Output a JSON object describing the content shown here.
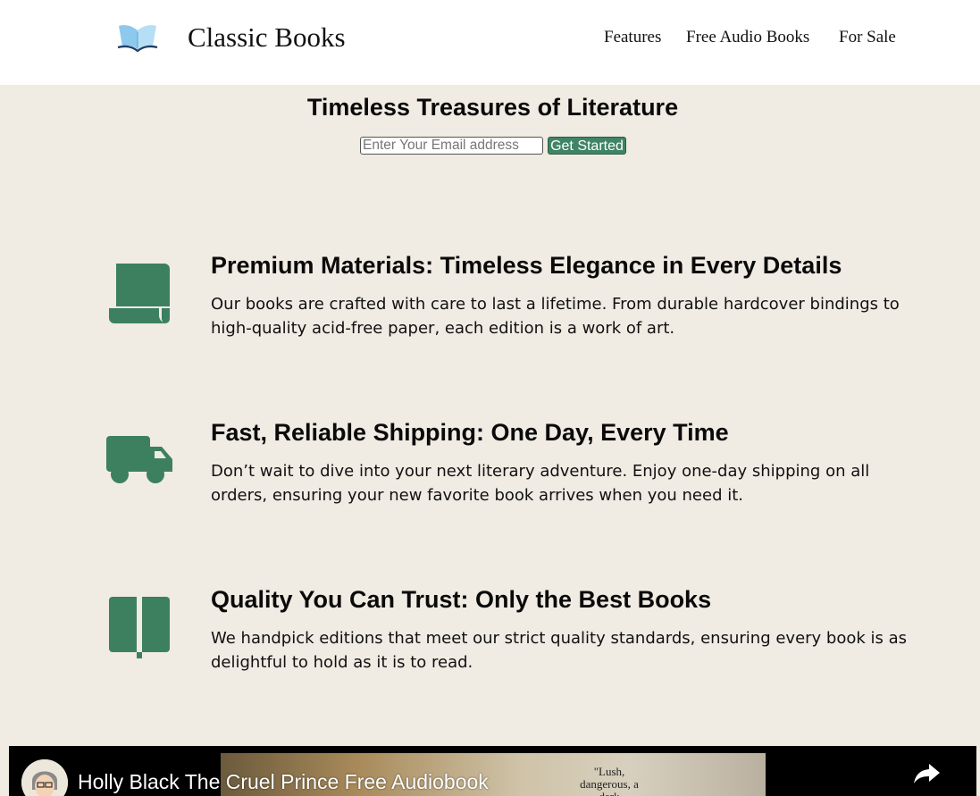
{
  "header": {
    "brand": "Classic Books",
    "nav": {
      "features": "Features",
      "audio": "Free Audio Books",
      "sale": "For Sale"
    }
  },
  "hero": {
    "title": "Timeless Treasures of Literature",
    "email_placeholder": "Enter Your Email address",
    "email_value": "",
    "cta_label": "Get Started"
  },
  "features": [
    {
      "icon": "scroll-icon",
      "title": "Premium Materials: Timeless Elegance in Every Details",
      "text": "Our books are crafted with care to last a lifetime. From durable hardcover bindings to high-quality acid-free paper, each edition is a work of art."
    },
    {
      "icon": "truck-icon",
      "title": "Fast, Reliable Shipping: One Day, Every Time",
      "text": "Don’t wait to dive into your next literary adventure. Enjoy one-day shipping on all orders, ensuring your new favorite book arrives when you need it."
    },
    {
      "icon": "book-open-icon",
      "title": "Quality You Can Trust: Only the Best Books",
      "text": "We handpick editions that meet our strict quality standards, ensuring every book is as delightful to hold as it is to read."
    }
  ],
  "video": {
    "title": "Holly Black The Cruel Prince Free Audiobook",
    "thumbnail_quote": "\"Lush, dangerous, a dark"
  },
  "colors": {
    "accent": "#3f8466",
    "icon": "#3c8060",
    "page_background": "#f0ebe3",
    "header_background": "#ffffff"
  }
}
